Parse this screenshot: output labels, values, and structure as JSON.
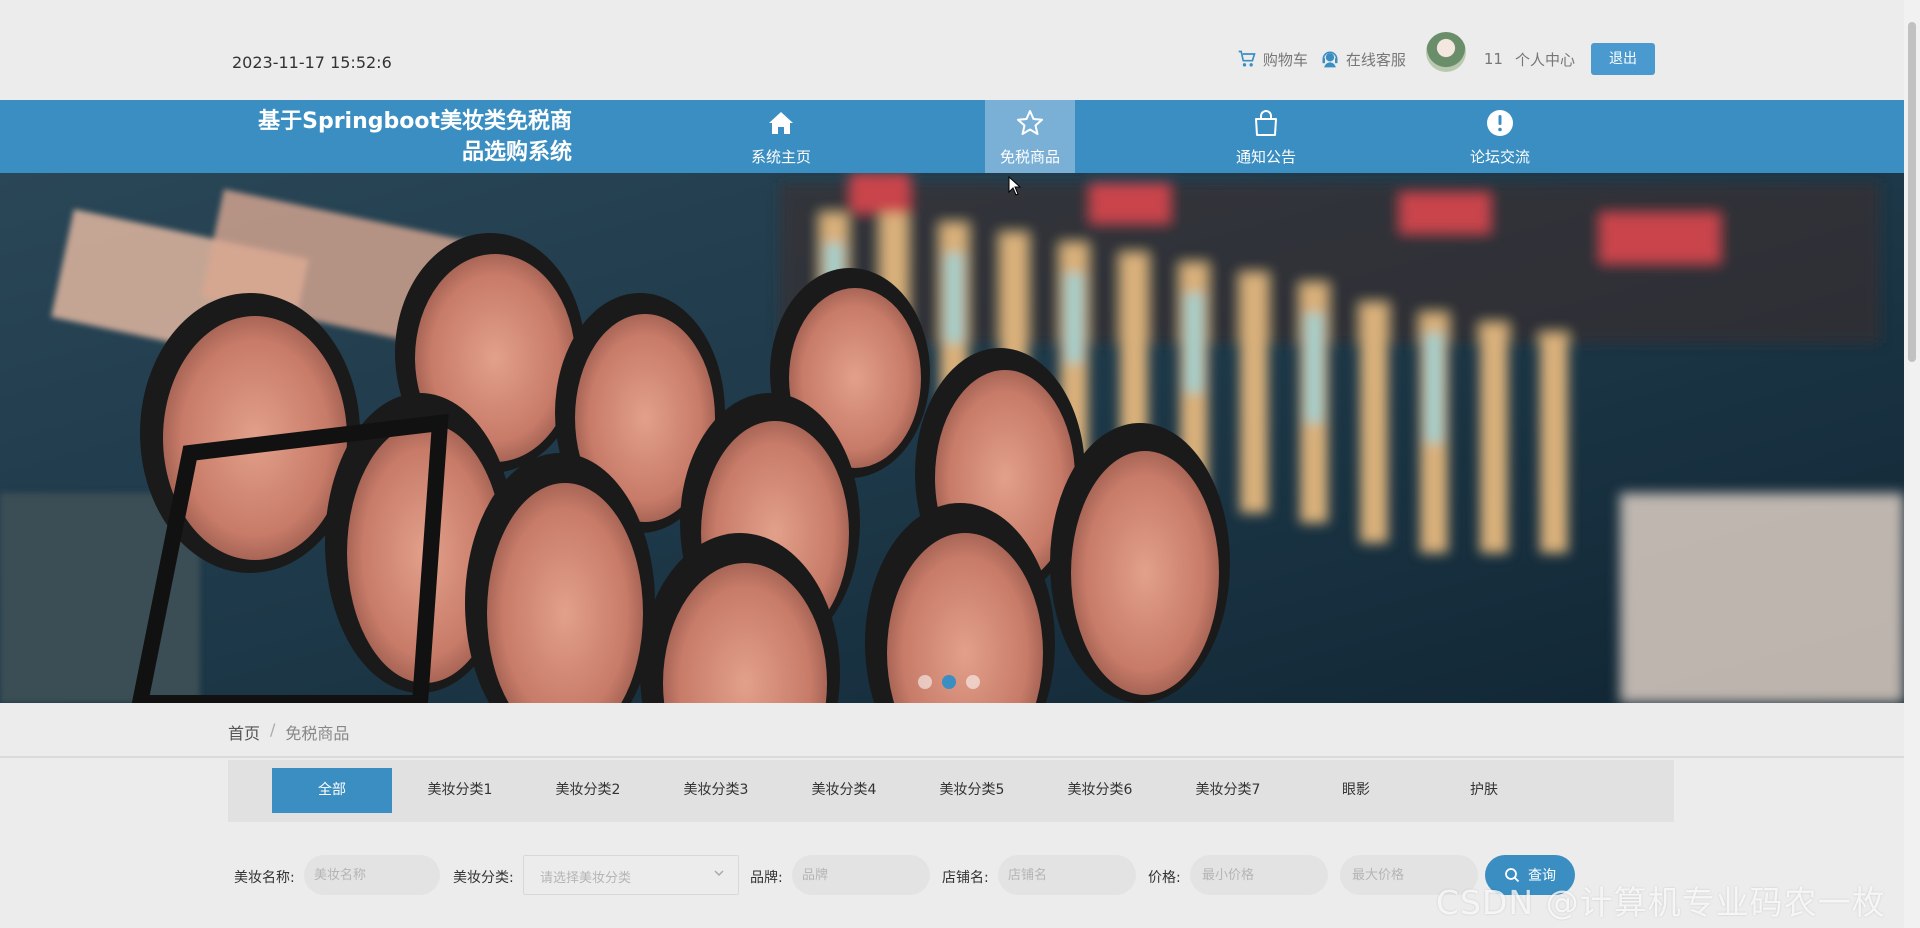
{
  "header": {
    "datetime": "2023-11-17 15:52:6",
    "cart_label": "购物车",
    "service_label": "在线客服",
    "username": "11",
    "profile_label": "个人中心",
    "logout_label": "退出"
  },
  "nav": {
    "title_line1": "基于Springboot美妆类免税商",
    "title_line2": "品选购系统",
    "items": [
      {
        "label": "系统主页",
        "icon": "home-icon"
      },
      {
        "label": "免税商品",
        "icon": "star-icon",
        "active": true
      },
      {
        "label": "通知公告",
        "icon": "bag-icon"
      },
      {
        "label": "论坛交流",
        "icon": "info-icon"
      }
    ]
  },
  "banner": {
    "dots": 3,
    "active_dot": 2
  },
  "breadcrumb": {
    "home": "首页",
    "separator": "/",
    "current": "免税商品"
  },
  "categories": [
    "全部",
    "美妆分类1",
    "美妆分类2",
    "美妆分类3",
    "美妆分类4",
    "美妆分类5",
    "美妆分类6",
    "美妆分类7",
    "眼影",
    "护肤"
  ],
  "search": {
    "name_label": "美妆名称:",
    "name_placeholder": "美妆名称",
    "category_label": "美妆分类:",
    "category_placeholder": "请选择美妆分类",
    "brand_label": "品牌:",
    "brand_placeholder": "品牌",
    "shop_label": "店铺名:",
    "shop_placeholder": "店铺名",
    "price_label": "价格:",
    "min_price_placeholder": "最小价格",
    "max_price_placeholder": "最大价格",
    "query_label": "查询"
  },
  "watermark": "CSDN @计算机专业码农一枚",
  "colors": {
    "primary": "#3b8ec2",
    "active_nav": "#7bb0d6"
  }
}
